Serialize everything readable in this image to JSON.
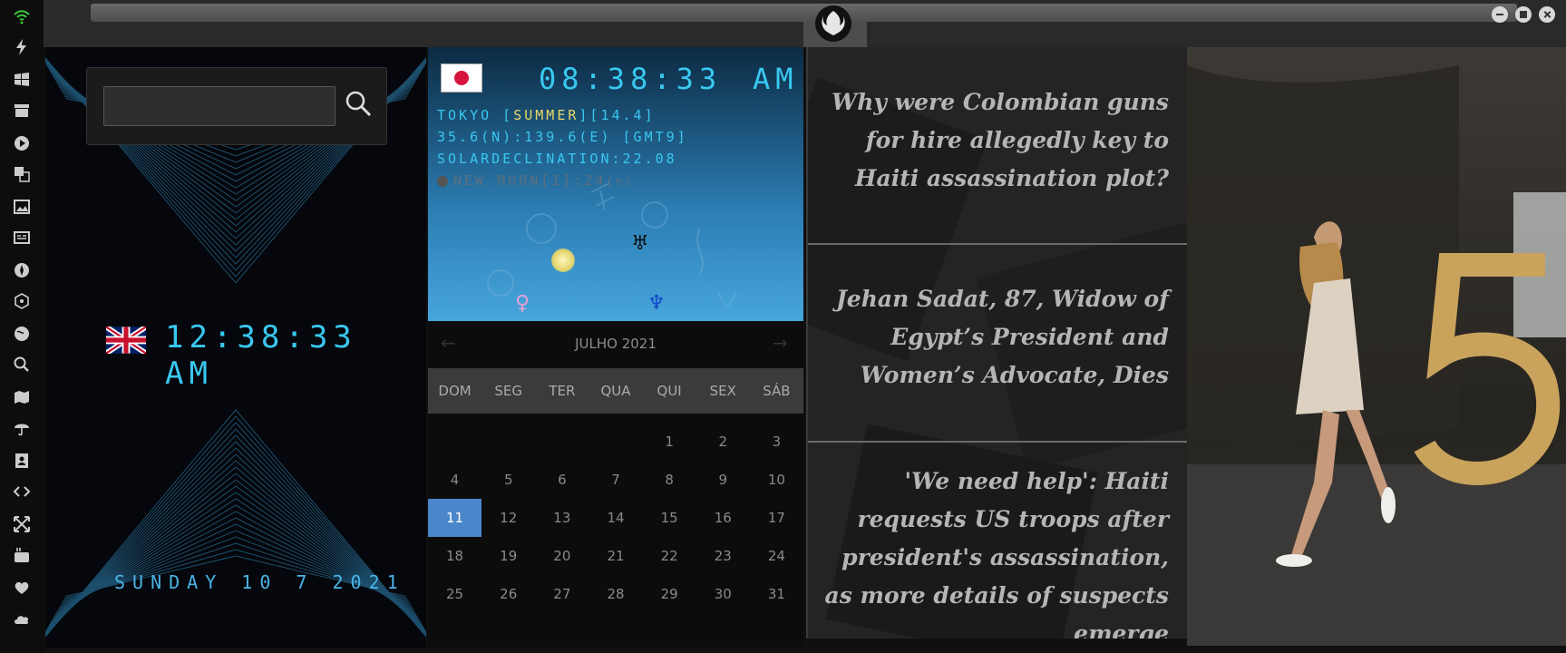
{
  "rail": {
    "icons": [
      "wifi-icon",
      "flash-icon",
      "windows-icon",
      "archive-icon",
      "play-icon",
      "translate-icon",
      "image-icon",
      "news-icon",
      "jedi-icon",
      "atom-icon",
      "globe-icon",
      "search-icon",
      "map-icon",
      "umbrella-icon",
      "contacts-icon",
      "code-icon",
      "expand-icon",
      "youtube-icon",
      "heart-icon",
      "cloud-icon"
    ]
  },
  "search": {
    "placeholder": ""
  },
  "uk_clock": {
    "time": "12:38:33 AM",
    "date": "SUNDAY 10 7 2021"
  },
  "tokyo_clock": {
    "time": "08:38:33",
    "ampm": "AM",
    "city_prefix": "TOKYO [",
    "season": "SUMMER",
    "city_suffix": "][14.4]",
    "coords": "35.6(N):139.6(E) [GMT9]",
    "solar": "SOLARDECLINATION:22.08",
    "moon": "NEW MOON[1]:24",
    "moon_suffix": "(n)",
    "planets": {
      "uranus": "♅",
      "venus": "♀",
      "neptune": "♆"
    }
  },
  "calendar": {
    "title": "JULHO 2021",
    "prev": "←",
    "next": "→",
    "weekdays": [
      "DOM",
      "SEG",
      "TER",
      "QUA",
      "QUI",
      "SEX",
      "SÁB"
    ],
    "weeks": [
      [
        "",
        "",
        "",
        "",
        "1",
        "2",
        "3"
      ],
      [
        "4",
        "5",
        "6",
        "7",
        "8",
        "9",
        "10"
      ],
      [
        "11",
        "12",
        "13",
        "14",
        "15",
        "16",
        "17"
      ],
      [
        "18",
        "19",
        "20",
        "21",
        "22",
        "23",
        "24"
      ],
      [
        "25",
        "26",
        "27",
        "28",
        "29",
        "30",
        "31"
      ]
    ],
    "selected": "11"
  },
  "news": [
    "Why were Colombian guns for hire allegedly key to Haiti assassination plot?",
    "Jehan Sadat, 87, Widow of Egypt’s President and Women’s Advocate, Dies",
    "'We need help': Haiti requests US troops after president's assassination, as more details of suspects emerge"
  ],
  "photo": {
    "sign": "5"
  },
  "colors": {
    "lcd": "#39c8f0",
    "accent": "#4a86c9",
    "season": "#e9d866"
  }
}
